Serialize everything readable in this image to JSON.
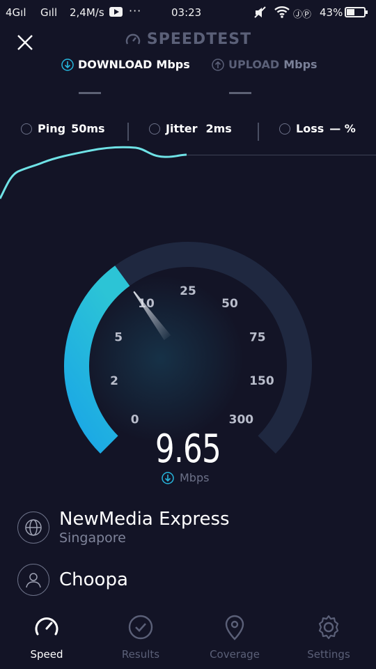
{
  "status_bar": {
    "network1": "4Gıl",
    "network2": "Gıll",
    "speed": "2,4M/s",
    "dots": "···",
    "time": "03:23",
    "battery": "43%"
  },
  "header": {
    "title": "SPEEDTEST",
    "download_label": "DOWNLOAD",
    "download_unit": "Mbps",
    "upload_label": "UPLOAD",
    "upload_unit": "Mbps"
  },
  "stats": {
    "ping_label": "Ping",
    "ping_value": "50ms",
    "jitter_label": "Jitter",
    "jitter_value": "2ms",
    "loss_label": "Loss",
    "loss_value": "— %"
  },
  "gauge": {
    "tick_labels": [
      "0",
      "2",
      "5",
      "10",
      "25",
      "50",
      "75",
      "150",
      "300"
    ],
    "current_value": 9.65,
    "reading": "9.65",
    "reading_unit": "Mbps",
    "colors": {
      "active": "#26b6dd",
      "track": "#1f2840",
      "needle": "#c8ccd8"
    }
  },
  "server": {
    "name": "NewMedia Express",
    "location": "Singapore",
    "provider": "Choopa"
  },
  "tabs": [
    {
      "label": "Speed",
      "icon": "gauge-icon",
      "active": true
    },
    {
      "label": "Results",
      "icon": "check-circle-icon",
      "active": false
    },
    {
      "label": "Coverage",
      "icon": "location-pin-icon",
      "active": false
    },
    {
      "label": "Settings",
      "icon": "gear-icon",
      "active": false
    }
  ]
}
